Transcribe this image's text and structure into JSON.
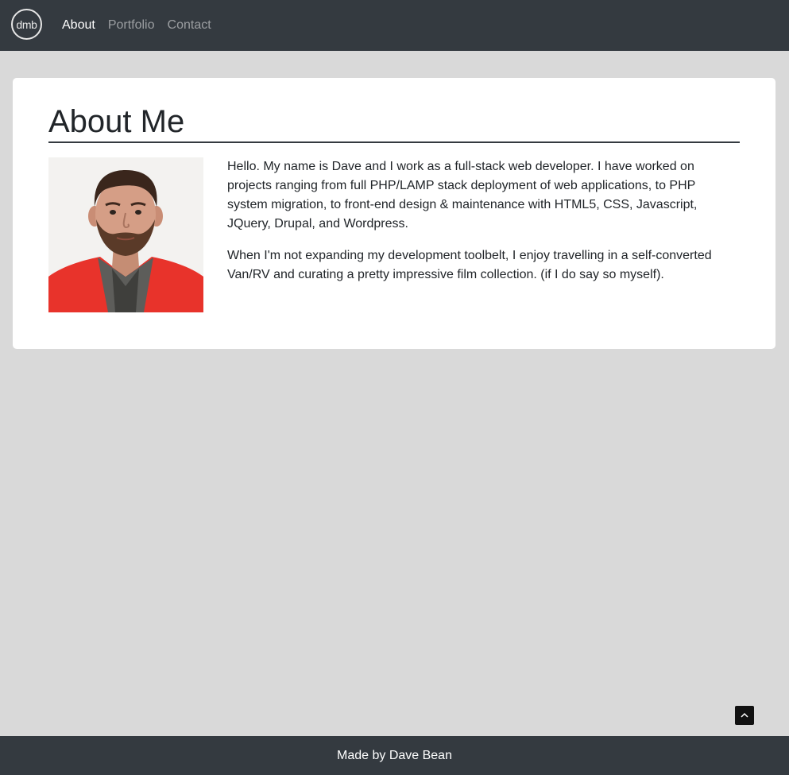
{
  "nav": {
    "logo_text": "dmb",
    "links": [
      {
        "label": "About",
        "active": true
      },
      {
        "label": "Portfolio",
        "active": false
      },
      {
        "label": "Contact",
        "active": false
      }
    ]
  },
  "about": {
    "title": "About Me",
    "paragraphs": [
      "Hello. My name is Dave and I work as a full-stack web developer. I have worked on projects ranging from full PHP/LAMP stack deployment of web applications, to PHP system migration, to front-end design & maintenance with HTML5, CSS, Javascript, JQuery, Drupal, and Wordpress.",
      "When I'm not expanding my development toolbelt, I enjoy travelling in a self-converted Van/RV and curating a pretty impressive film collection. (if I do say so myself)."
    ]
  },
  "scroll_top": {
    "icon": "chevron-up-icon"
  },
  "footer": {
    "text": "Made by Dave Bean"
  },
  "colors": {
    "navbar_bg": "#343a40",
    "page_bg": "#d9d9d9",
    "card_bg": "#ffffff",
    "text": "#212529"
  }
}
